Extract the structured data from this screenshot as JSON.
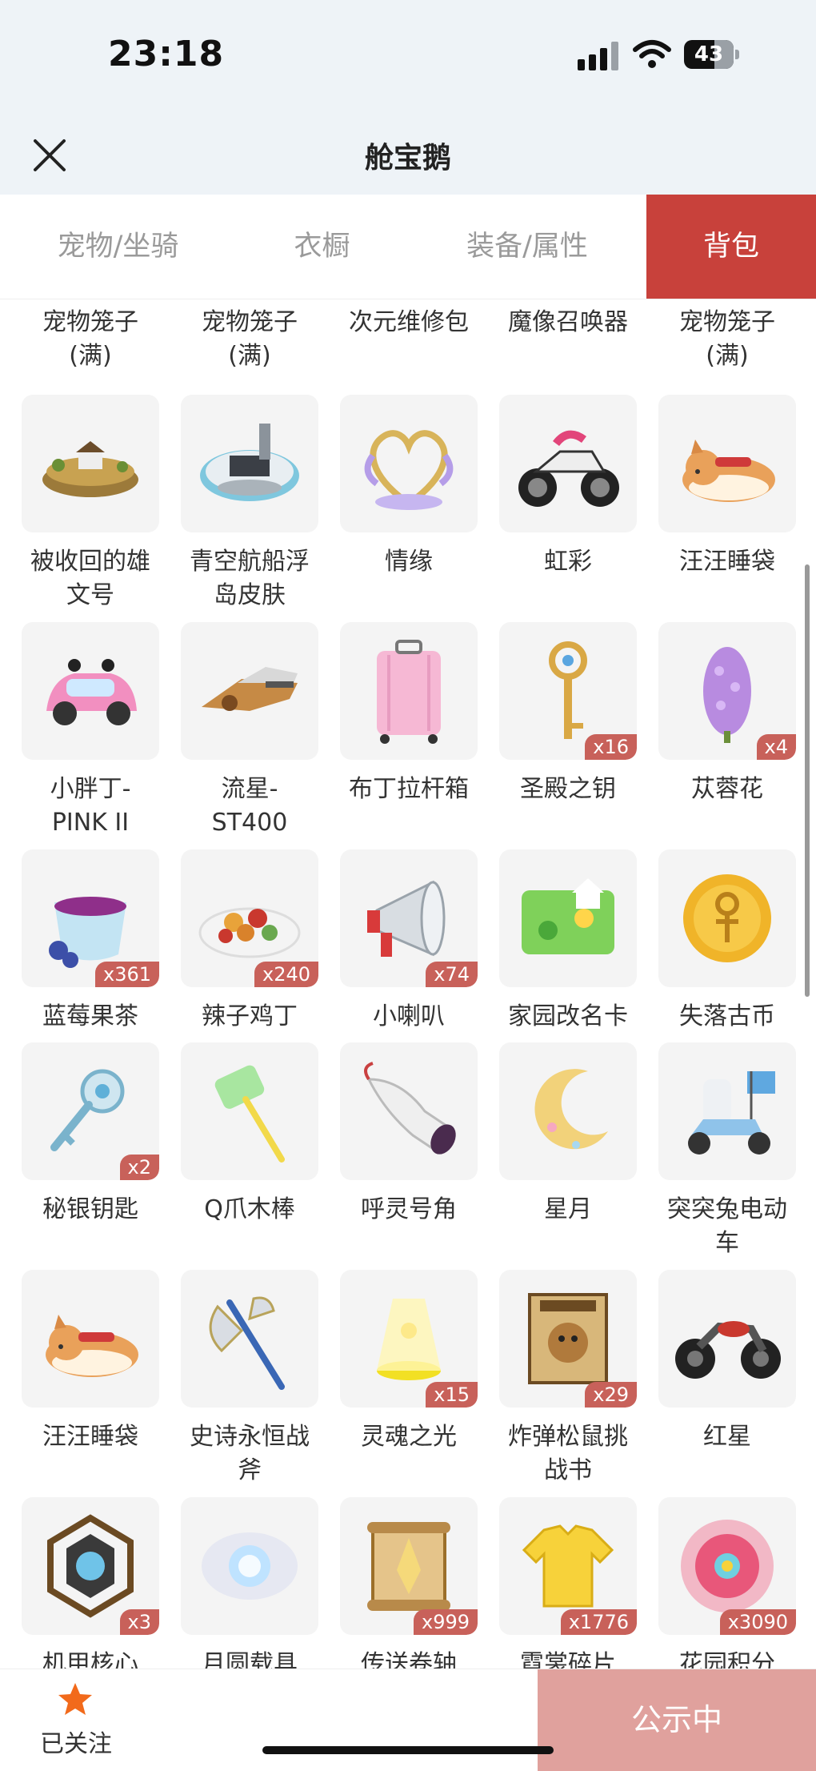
{
  "status": {
    "time": "23:18",
    "battery": "43"
  },
  "header": {
    "title": "舱宝鹅"
  },
  "tabs": [
    {
      "label": "宠物/坐骑",
      "active": false
    },
    {
      "label": "衣橱",
      "active": false
    },
    {
      "label": "装备/属性",
      "active": false
    },
    {
      "label": "背包",
      "active": true
    }
  ],
  "top_row": [
    {
      "name": "宠物笼子\n(满)"
    },
    {
      "name": "宠物笼子\n(满)"
    },
    {
      "name": "次元维修包"
    },
    {
      "name": "魔像召唤器"
    },
    {
      "name": "宠物笼子\n(满)"
    }
  ],
  "items": [
    {
      "name": "被收回的雄\n文号",
      "badge": "",
      "icon": "island-icon"
    },
    {
      "name": "青空航船浮\n岛皮肤",
      "badge": "",
      "icon": "floating-island-icon"
    },
    {
      "name": "情缘",
      "badge": "",
      "icon": "heart-icon"
    },
    {
      "name": "虹彩",
      "badge": "",
      "icon": "motorcycle-icon"
    },
    {
      "name": "汪汪睡袋",
      "badge": "",
      "icon": "dog-icon"
    },
    {
      "name": "小胖丁-\nPINK II",
      "badge": "",
      "icon": "car-icon"
    },
    {
      "name": "流星-\nST400",
      "badge": "",
      "icon": "jet-icon"
    },
    {
      "name": "布丁拉杆箱",
      "badge": "",
      "icon": "suitcase-icon"
    },
    {
      "name": "圣殿之钥",
      "badge": "x16",
      "icon": "golden-key-icon"
    },
    {
      "name": "苁蓉花",
      "badge": "x4",
      "icon": "flower-icon"
    },
    {
      "name": "蓝莓果茶",
      "badge": "x361",
      "icon": "tea-icon"
    },
    {
      "name": "辣子鸡丁",
      "badge": "x240",
      "icon": "dish-icon"
    },
    {
      "name": "小喇叭",
      "badge": "x74",
      "icon": "megaphone-icon"
    },
    {
      "name": "家园改名卡",
      "badge": "",
      "icon": "card-icon"
    },
    {
      "name": "失落古币",
      "badge": "",
      "icon": "coin-icon"
    },
    {
      "name": "秘银钥匙",
      "badge": "x2",
      "icon": "silver-key-icon"
    },
    {
      "name": "Q爪木棒",
      "badge": "",
      "icon": "hammer-icon"
    },
    {
      "name": "呼灵号角",
      "badge": "",
      "icon": "horn-icon"
    },
    {
      "name": "星月",
      "badge": "",
      "icon": "moon-icon"
    },
    {
      "name": "突突兔电动\n车",
      "badge": "",
      "icon": "scooter-icon"
    },
    {
      "name": "汪汪睡袋",
      "badge": "",
      "icon": "dog-icon"
    },
    {
      "name": "史诗永恒战\n斧",
      "badge": "",
      "icon": "axe-icon"
    },
    {
      "name": "灵魂之光",
      "badge": "x15",
      "icon": "light-icon"
    },
    {
      "name": "炸弹松鼠挑\n战书",
      "badge": "x29",
      "icon": "wanted-poster-icon"
    },
    {
      "name": "红星",
      "badge": "",
      "icon": "bike-icon"
    },
    {
      "name": "机甲核心",
      "badge": "x3",
      "icon": "core-icon"
    },
    {
      "name": "月圆载具",
      "badge": "",
      "icon": "orb-icon"
    },
    {
      "name": "传送卷轴",
      "badge": "x999",
      "icon": "scroll-icon"
    },
    {
      "name": "霓裳碎片",
      "badge": "x1776",
      "icon": "shirt-icon"
    },
    {
      "name": "花园积分",
      "badge": "x3090",
      "icon": "badge-flower-icon"
    }
  ],
  "footer": {
    "follow_label": "已关注",
    "publish_label": "公示中"
  },
  "colors": {
    "accent": "#c8413b",
    "badge": "#c8615a",
    "publish": "#e0a19d",
    "star": "#f26a1b"
  }
}
